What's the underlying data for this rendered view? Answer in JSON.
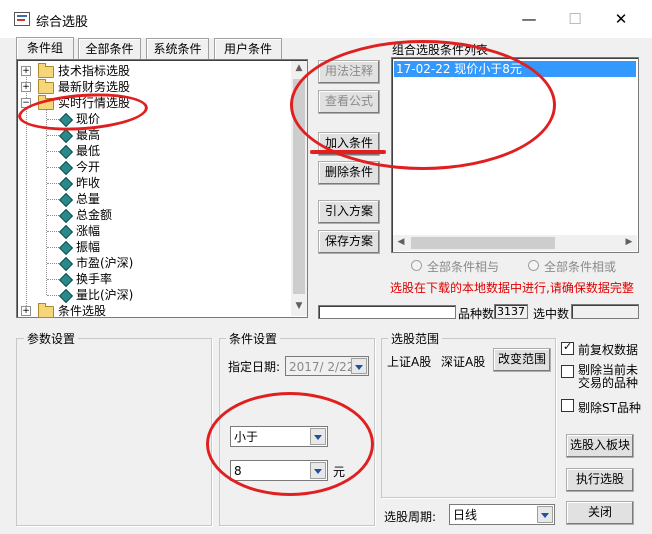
{
  "window": {
    "title": "综合选股",
    "min": "—",
    "max": "☐",
    "close": "✕"
  },
  "tabs": [
    "条件组",
    "全部条件",
    "系统条件",
    "用户条件"
  ],
  "tree": {
    "groups": [
      "技术指标选股",
      "最新财务选股",
      "实时行情选股"
    ],
    "items": [
      "现价",
      "最高",
      "最低",
      "今开",
      "昨收",
      "总量",
      "总金额",
      "涨幅",
      "振幅",
      "市盈(沪深)",
      "换手率",
      "量比(沪深)"
    ],
    "last_group": "条件选股"
  },
  "mid_buttons": {
    "usage": "用法注释",
    "formula": "查看公式",
    "add": "加入条件",
    "delete": "删除条件",
    "import": "引入方案",
    "save": "保存方案"
  },
  "condition_list": {
    "title": "组合选股条件列表",
    "items": [
      "17-02-22 现价小于8元"
    ]
  },
  "logic": {
    "and": "全部条件相与",
    "or": "全部条件相或"
  },
  "warning": "选股在下载的本地数据中进行,请确保数据完整",
  "counts": {
    "total_label": "品种数",
    "total_value": "3137",
    "selected_label": "选中数",
    "selected_value": ""
  },
  "param_settings": {
    "title": "参数设置"
  },
  "cond_settings": {
    "title": "条件设置",
    "date_label": "指定日期:",
    "date_value": "2017/ 2/22",
    "operator": "小于",
    "value": "8",
    "unit": "元"
  },
  "range": {
    "title": "选股范围",
    "sh": "上证A股",
    "sz": "深证A股",
    "change": "改变范围",
    "period_label": "选股周期:",
    "period_value": "日线"
  },
  "options": {
    "adjust": "前复权数据",
    "exclude_notrade_1": "剔除当前未",
    "exclude_notrade_2": "交易的品种",
    "exclude_st": "剔除ST品种"
  },
  "right_buttons": {
    "to_board": "选股入板块",
    "run": "执行选股",
    "close": "关闭"
  },
  "colors": {
    "selected_bg": "#3399ff",
    "warning": "#e00000",
    "annotation": "#e02020"
  }
}
